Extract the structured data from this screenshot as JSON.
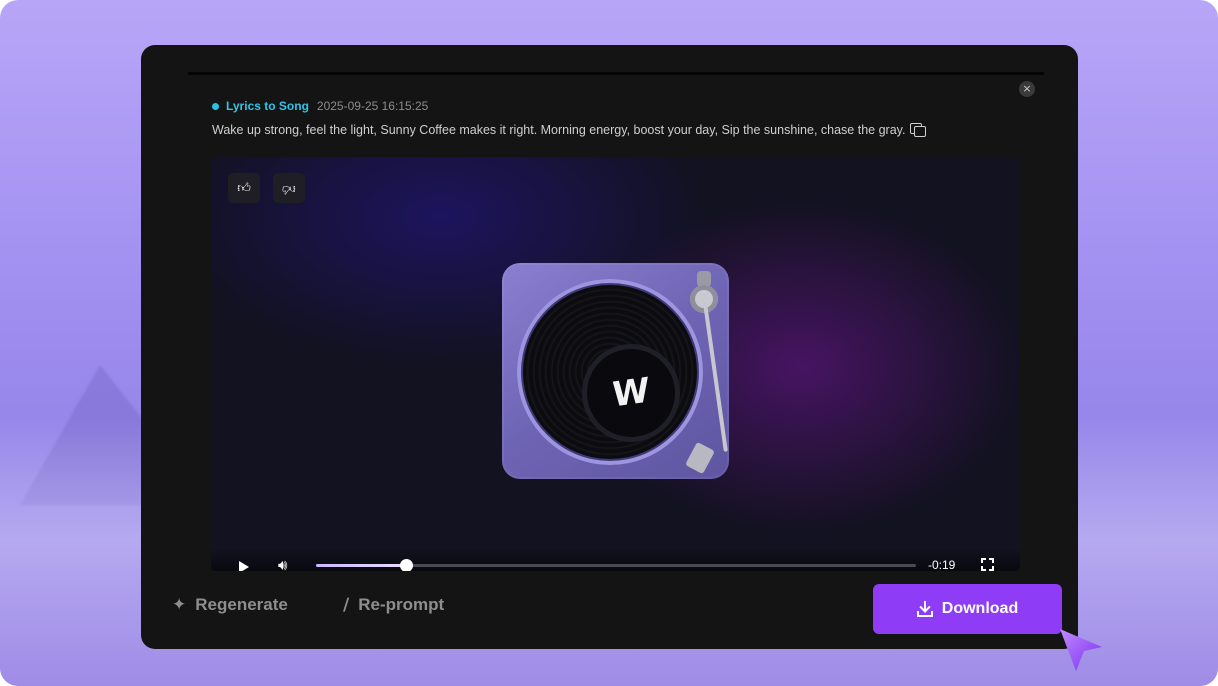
{
  "dialog": {
    "close_symbol": "×"
  },
  "result": {
    "tag": "Lyrics to Song",
    "timestamp": "2025-09-25 16:15:25",
    "lyrics": "Wake up strong, feel the light, Sunny Coffee makes it right. Morning energy, boost your day, Sip the sunshine, chase the gray."
  },
  "player": {
    "time_remaining": "-0:19",
    "progress_fraction": 0.15,
    "feedback": {
      "like_icon": "thumbs-up-icon",
      "dislike_icon": "thumbs-down-icon"
    },
    "artwork_icon": "turntable-icon"
  },
  "actions": {
    "regenerate_label": "Regenerate",
    "reprompt_label": "Re-prompt",
    "download_label": "Download"
  },
  "colors": {
    "accent": "#8f3cf7",
    "tag": "#2ec5ea",
    "card": "#141414"
  }
}
